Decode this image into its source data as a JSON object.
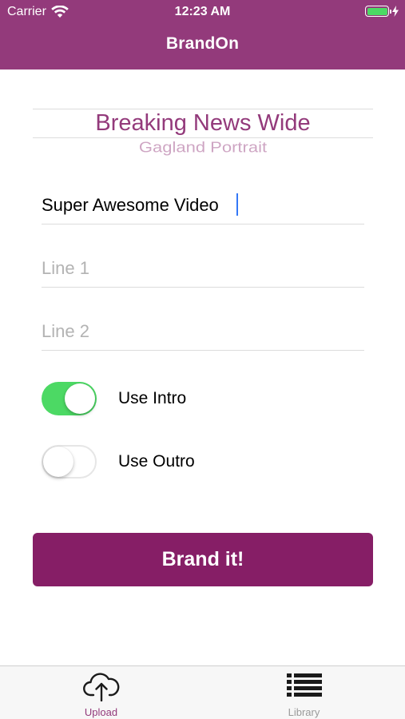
{
  "status_bar": {
    "carrier": "Carrier",
    "time": "12:23 AM",
    "battery_level": 1.0,
    "battery_color": "#4cd964"
  },
  "nav_bar": {
    "title": "BrandOn",
    "background": "#933a7b"
  },
  "template_picker": {
    "selected": "Breaking News Wide",
    "next": "Gagland Portrait"
  },
  "form": {
    "title_field": {
      "value": "Super Awesome Video",
      "placeholder": ""
    },
    "line1_field": {
      "value": "",
      "placeholder": "Line 1"
    },
    "line2_field": {
      "value": "",
      "placeholder": "Line 2"
    },
    "use_intro": {
      "label": "Use Intro",
      "on": true
    },
    "use_outro": {
      "label": "Use Outro",
      "on": false
    }
  },
  "brand_button": {
    "label": "Brand it!",
    "color": "#861e66"
  },
  "tab_bar": {
    "tabs": [
      {
        "label": "Upload",
        "icon": "cloud-upload-icon",
        "active": true
      },
      {
        "label": "Library",
        "icon": "list-icon",
        "active": false
      }
    ],
    "active_color": "#933a7b",
    "inactive_color": "#9a9a9a"
  }
}
